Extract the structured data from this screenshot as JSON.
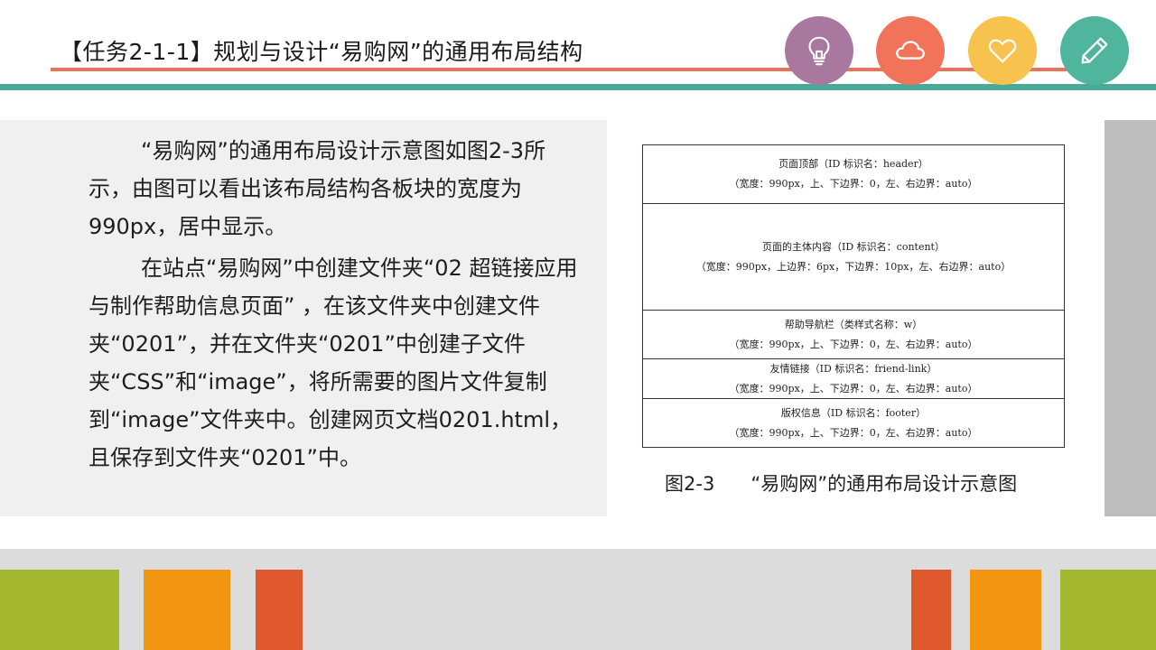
{
  "slide": {
    "title": "【任务2-1-1】规划与设计“易购网”的通用布局结构",
    "icons": [
      "lightbulb-icon",
      "cloud-icon",
      "heart-icon",
      "pencil-icon"
    ],
    "colors": {
      "title_line": "#e8735a",
      "teal_bar": "#4ea896",
      "lightbulb_circle": "#a8789f",
      "cloud_circle": "#f0735a",
      "heart_circle": "#f8c24e",
      "pencil_circle": "#4fb59c",
      "stripe_green": "#a3b82f",
      "stripe_orange": "#f29611",
      "stripe_red": "#e0592e"
    }
  },
  "body": {
    "paragraph1": "“易购网”的通用布局设计示意图如图2-3所示，由图可以看出该布局结构各板块的宽度为990px，居中显示。",
    "paragraph2": "在站点“易购网”中创建文件夹“02 超链接应用与制作帮助信息页面” ，在该文件夹中创建文件夹“0201”，并在文件夹“0201”中创建子文件夹“CSS”和“image”，将所需要的图片文件复制到“image”文件夹中。创建网页文档0201.html，且保存到文件夹“0201”中。"
  },
  "diagram": {
    "blocks": [
      {
        "name": "页面顶部（ID 标识名：header）",
        "spec": "（宽度：990px，上、下边界：0，左、右边界：auto）"
      },
      {
        "name": "页面的主体内容（ID 标识名：content）",
        "spec": "（宽度：990px，上边界：6px，下边界：10px，左、右边界：auto）"
      },
      {
        "name": "帮助导航栏（类样式名称：w）",
        "spec": "（宽度：990px，上、下边界：0，左、右边界：auto）"
      },
      {
        "name": "友情链接（ID 标识名：friend-link）",
        "spec": "（宽度：990px，上、下边界：0，左、右边界：auto）"
      },
      {
        "name": "版权信息（ID 标识名：footer）",
        "spec": "（宽度：990px，上、下边界：0，左、右边界：auto）"
      }
    ],
    "caption": "图2-3      “易购网”的通用布局设计示意图"
  }
}
